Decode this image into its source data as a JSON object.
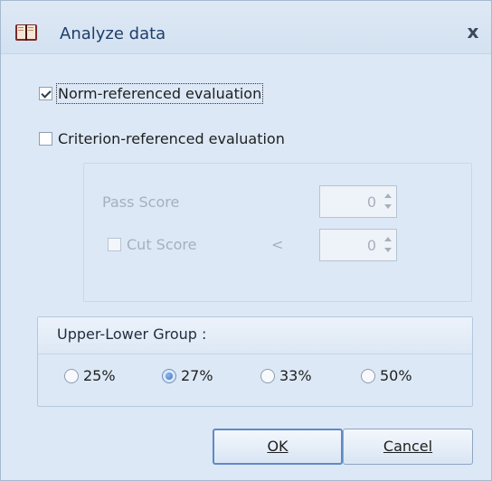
{
  "window": {
    "title": "Analyze data",
    "close_glyph": "x",
    "icon": "book-icon"
  },
  "evaluation": {
    "norm": {
      "label": "Norm-referenced evaluation",
      "checked": true
    },
    "criterion": {
      "label": "Criterion-referenced evaluation",
      "checked": false
    }
  },
  "criterion_panel": {
    "pass_score_label": "Pass Score",
    "pass_score_value": "0",
    "cut_score_label": "Cut Score",
    "cut_score_checked": false,
    "cut_score_operator": "<",
    "cut_score_value": "0"
  },
  "upper_lower_group": {
    "title": "Upper-Lower Group :",
    "options": [
      "25%",
      "27%",
      "33%",
      "50%"
    ],
    "selected": "27%"
  },
  "buttons": {
    "ok_label": "OK",
    "cancel_label": "Cancel"
  },
  "colors": {
    "content_bg": "#dce8f6",
    "title_text": "#1f3e6a",
    "disabled_text": "#a6b0bd",
    "default_button_border": "#5f8ac5"
  }
}
